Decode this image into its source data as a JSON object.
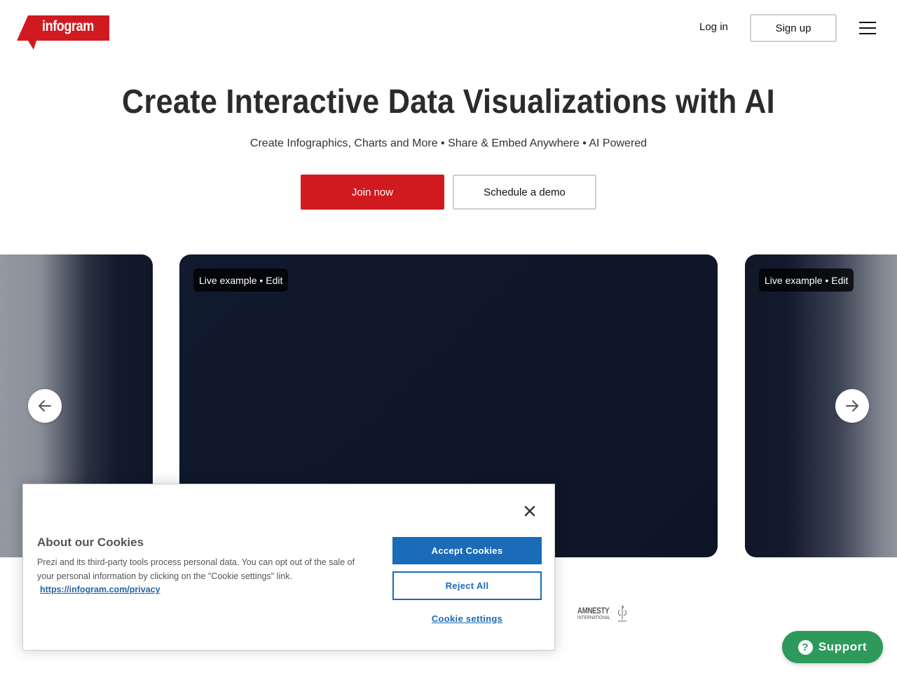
{
  "header": {
    "logo_text": "infogram",
    "login_label": "Log in",
    "signup_label": "Sign up",
    "menu_icon": "hamburger-menu-icon"
  },
  "hero": {
    "title": "Create Interactive Data Visualizations with AI",
    "subtitle": "Create Infographics, Charts and More • Share & Embed Anywhere • AI Powered",
    "join_label": "Join now",
    "demo_label": "Schedule a demo"
  },
  "carousel": {
    "badge_prefix": "Live example •",
    "badge_edit": "Edit",
    "prev_icon": "arrow-left-icon",
    "next_icon": "arrow-right-icon"
  },
  "logos": {
    "amnesty_name": "AMNESTY",
    "amnesty_sub": "INTERNATIONAL"
  },
  "cookie": {
    "title": "About our Cookies",
    "text": "Prezi and its third-party tools process personal data. You can opt out of the sale of your personal information by clicking on the \"Cookie settings\" link.",
    "link": "https://infogram.com/privacy",
    "accept_label": "Accept Cookies",
    "reject_label": "Reject All",
    "settings_label": "Cookie settings"
  },
  "support": {
    "label": "Support",
    "icon_glyph": "?"
  },
  "colors": {
    "brand_red": "#d11a1f",
    "card_navy": "#0f1729",
    "cookie_blue": "#1a6bb8",
    "support_green": "#2d9a5b"
  }
}
